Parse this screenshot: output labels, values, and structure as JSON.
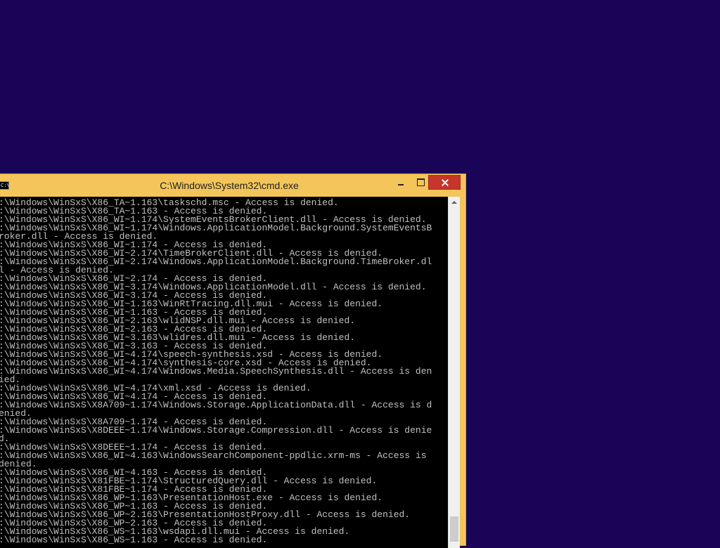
{
  "window": {
    "title": "C:\\Windows\\System32\\cmd.exe",
    "icon_text": "C:\\",
    "icon": "cmd-icon",
    "close_color": "#c7362b",
    "frame_color": "#f3c55a"
  },
  "desktop": {
    "background_color": "#1a0458"
  },
  "console": {
    "foreground_color": "#c0c0c0",
    "background_color": "#000000",
    "lines": [
      ":\\Windows\\WinSxS\\X86_TA~1.163\\taskschd.msc - Access is denied.",
      ":\\Windows\\WinSxS\\X86_TA~1.163 - Access is denied.",
      ":\\Windows\\WinSxS\\X86_WI~1.174\\SystemEventsBrokerClient.dll - Access is denied.",
      ":\\Windows\\WinSxS\\X86_WI~1.174\\Windows.ApplicationModel.Background.SystemEventsB",
      "roker.dll - Access is denied.",
      ":\\Windows\\WinSxS\\X86_WI~1.174 - Access is denied.",
      ":\\Windows\\WinSxS\\X86_WI~2.174\\TimeBrokerClient.dll - Access is denied.",
      ":\\Windows\\WinSxS\\X86_WI~2.174\\Windows.ApplicationModel.Background.TimeBroker.dl",
      "l - Access is denied.",
      ":\\Windows\\WinSxS\\X86_WI~2.174 - Access is denied.",
      ":\\Windows\\WinSxS\\X86_WI~3.174\\Windows.ApplicationModel.dll - Access is denied.",
      ":\\Windows\\WinSxS\\X86_WI~3.174 - Access is denied.",
      ":\\Windows\\WinSxS\\X86_WI~1.163\\WinRtTracing.dll.mui - Access is denied.",
      ":\\Windows\\WinSxS\\X86_WI~1.163 - Access is denied.",
      ":\\Windows\\WinSxS\\X86_WI~2.163\\wlidNSP.dll.mui - Access is denied.",
      ":\\Windows\\WinSxS\\X86_WI~2.163 - Access is denied.",
      ":\\Windows\\WinSxS\\X86_WI~3.163\\wlidres.dll.mui - Access is denied.",
      ":\\Windows\\WinSxS\\X86_WI~3.163 - Access is denied.",
      ":\\Windows\\WinSxS\\X86_WI~4.174\\speech-synthesis.xsd - Access is denied.",
      ":\\Windows\\WinSxS\\X86_WI~4.174\\synthesis-core.xsd - Access is denied.",
      ":\\Windows\\WinSxS\\X86_WI~4.174\\Windows.Media.SpeechSynthesis.dll - Access is den",
      "ied.",
      ":\\Windows\\WinSxS\\X86_WI~4.174\\xml.xsd - Access is denied.",
      ":\\Windows\\WinSxS\\X86_WI~4.174 - Access is denied.",
      ":\\Windows\\WinSxS\\X8A709~1.174\\Windows.Storage.ApplicationData.dll - Access is d",
      "enied.",
      ":\\Windows\\WinSxS\\X8A709~1.174 - Access is denied.",
      ":\\Windows\\WinSxS\\X8DEEE~1.174\\Windows.Storage.Compression.dll - Access is denie",
      "d.",
      ":\\Windows\\WinSxS\\X8DEEE~1.174 - Access is denied.",
      ":\\Windows\\WinSxS\\X86_WI~4.163\\WindowsSearchComponent-ppdlic.xrm-ms - Access is",
      "denied.",
      ":\\Windows\\WinSxS\\X86_WI~4.163 - Access is denied.",
      ":\\Windows\\WinSxS\\X81FBE~1.174\\StructuredQuery.dll - Access is denied.",
      ":\\Windows\\WinSxS\\X81FBE~1.174 - Access is denied.",
      ":\\Windows\\WinSxS\\X86_WP~1.163\\PresentationHost.exe - Access is denied.",
      ":\\Windows\\WinSxS\\X86_WP~1.163 - Access is denied.",
      ":\\Windows\\WinSxS\\X86_WP~2.163\\PresentationHostProxy.dll - Access is denied.",
      ":\\Windows\\WinSxS\\X86_WP~2.163 - Access is denied.",
      ":\\Windows\\WinSxS\\X86_WS~1.163\\wsdapi.dll.mui - Access is denied.",
      ":\\Windows\\WinSxS\\X86_WS~1.163 - Access is denied."
    ]
  },
  "scrollbar": {
    "position_fraction": 0.98
  }
}
